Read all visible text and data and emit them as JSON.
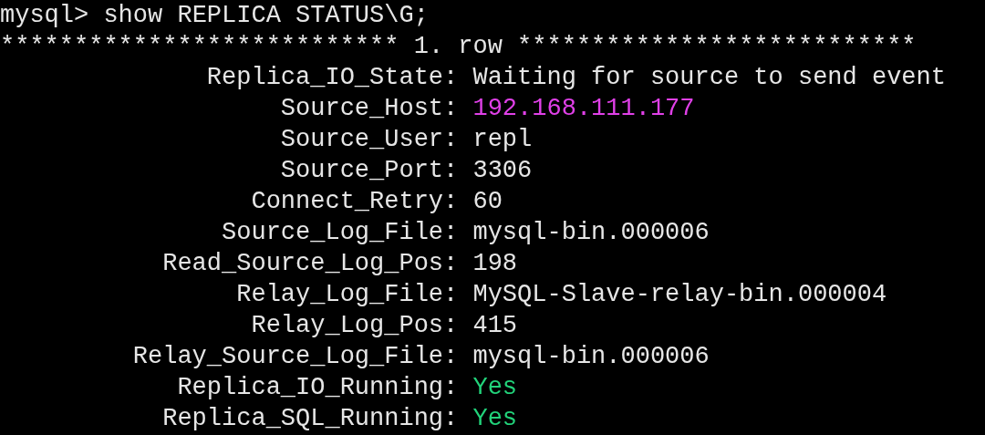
{
  "prompt": "mysql> show REPLICA STATUS\\G;",
  "row_header": "*************************** 1. row ***************************",
  "fields": [
    {
      "label": "Replica_IO_State:",
      "value": "Waiting for source to send event",
      "color": "#e6e6e6"
    },
    {
      "label": "Source_Host:",
      "value": "192.168.111.177",
      "color": "#e040e8"
    },
    {
      "label": "Source_User:",
      "value": "repl",
      "color": "#e6e6e6"
    },
    {
      "label": "Source_Port:",
      "value": "3306",
      "color": "#e6e6e6"
    },
    {
      "label": "Connect_Retry:",
      "value": "60",
      "color": "#e6e6e6"
    },
    {
      "label": "Source_Log_File:",
      "value": "mysql-bin.000006",
      "color": "#e6e6e6"
    },
    {
      "label": "Read_Source_Log_Pos:",
      "value": "198",
      "color": "#e6e6e6"
    },
    {
      "label": "Relay_Log_File:",
      "value": "MySQL-Slave-relay-bin.000004",
      "color": "#e6e6e6"
    },
    {
      "label": "Relay_Log_Pos:",
      "value": "415",
      "color": "#e6e6e6"
    },
    {
      "label": "Relay_Source_Log_File:",
      "value": "mysql-bin.000006",
      "color": "#e6e6e6"
    },
    {
      "label": "Replica_IO_Running:",
      "value": "Yes",
      "color": "#22d37a"
    },
    {
      "label": "Replica_SQL_Running:",
      "value": "Yes",
      "color": "#22d37a"
    }
  ]
}
